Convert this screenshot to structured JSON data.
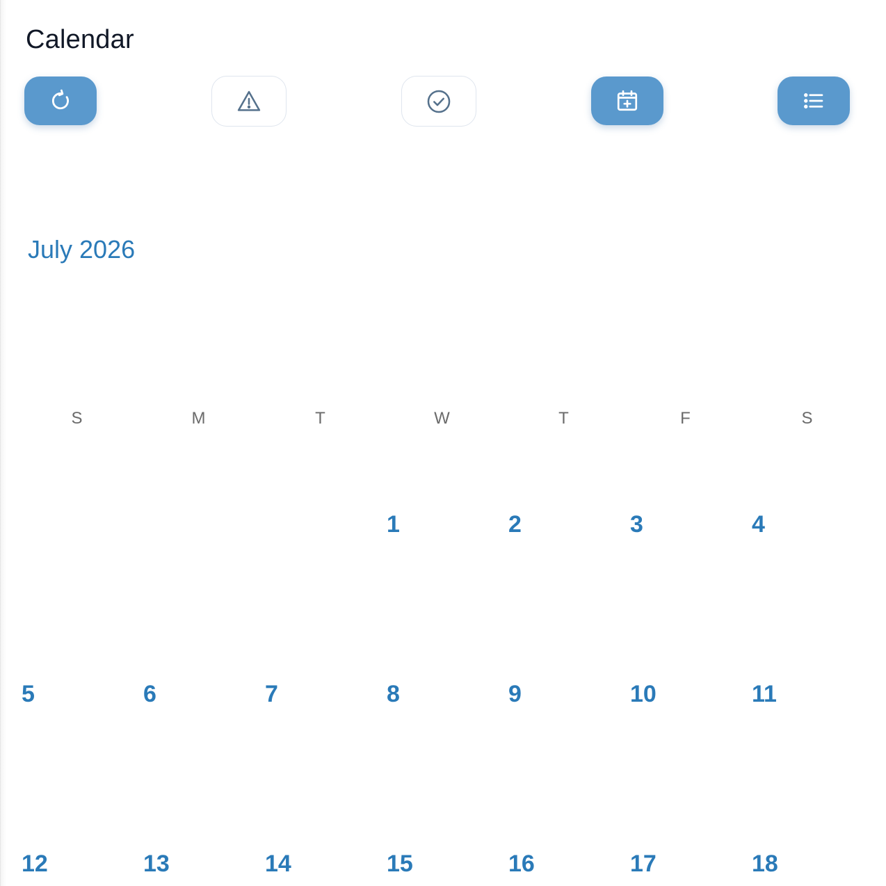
{
  "header": {
    "title": "Calendar"
  },
  "toolbar": {
    "buttons": [
      {
        "icon": "refresh-icon",
        "style": "filled"
      },
      {
        "icon": "warning-icon",
        "style": "outline"
      },
      {
        "icon": "check-circle-icon",
        "style": "outline"
      },
      {
        "icon": "calendar-add-icon",
        "style": "filled"
      },
      {
        "icon": "list-icon",
        "style": "filled"
      }
    ]
  },
  "calendar": {
    "month_label": "July 2026",
    "weekdays": [
      "S",
      "M",
      "T",
      "W",
      "T",
      "F",
      "S"
    ],
    "first_weekday_index": 3,
    "days": [
      "1",
      "2",
      "3",
      "4",
      "5",
      "6",
      "7",
      "8",
      "9",
      "10",
      "11",
      "12",
      "13",
      "14",
      "15",
      "16",
      "17",
      "18"
    ]
  },
  "colors": {
    "accent": "#5a99cd",
    "day_number": "#2a7ab8",
    "title_text": "#111827",
    "weekday_text": "#6b6b6b"
  }
}
